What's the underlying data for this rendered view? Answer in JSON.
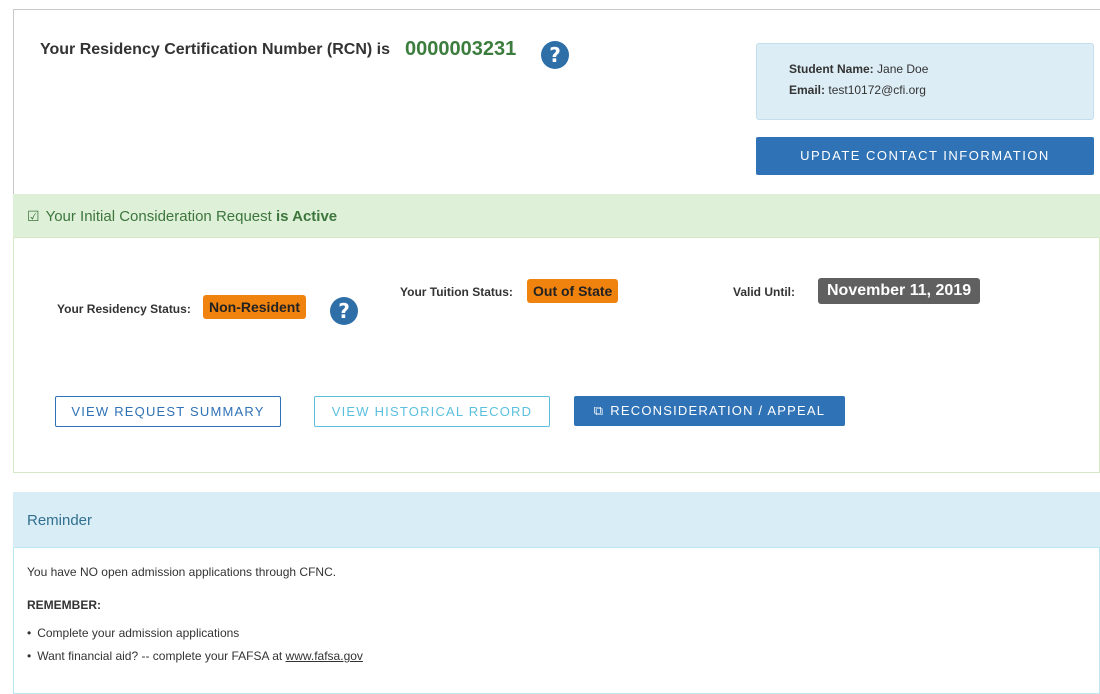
{
  "rcn": {
    "title": "Your Residency Certification Number (RCN) is",
    "number": "0000003231",
    "help_glyph": "?"
  },
  "contact": {
    "name_label": "Student Name:",
    "name_value": "Jane Doe",
    "email_label": "Email:",
    "email_value": "test10172@cfi.org",
    "update_button": "UPDATE CONTACT INFORMATION"
  },
  "consideration": {
    "check_glyph": "☑",
    "title_prefix": "Your Initial Consideration Request",
    "title_suffix": "is Active",
    "residency_label": "Your Residency Status:",
    "residency_value": "Non-Resident",
    "residency_help_glyph": "?",
    "tuition_label": "Your Tuition Status:",
    "tuition_value": "Out of State",
    "valid_label": "Valid Until:",
    "valid_value": "November 11, 2019",
    "buttons": {
      "summary": "VIEW REQUEST SUMMARY",
      "history": "VIEW HISTORICAL RECORD",
      "appeal_icon": "⧉",
      "appeal": "RECONSIDERATION / APPEAL"
    }
  },
  "reminder": {
    "title": "Reminder",
    "message": "You have NO open admission applications through CFNC.",
    "remember_label": "REMEMBER:",
    "bullet_glyph": "•",
    "bullet1": "Complete your admission applications",
    "bullet2_prefix": "Want financial aid? -- complete your FAFSA at",
    "bullet2_link": "www.fafsa.gov"
  },
  "colors": {
    "rcn_green": "#3c7d3e",
    "primary_blue": "#2f72b5",
    "info_blue": "#5bc0de",
    "warning_orange": "#f0830e",
    "success_bg": "#dff0d8",
    "info_bg": "#d9edf7"
  }
}
